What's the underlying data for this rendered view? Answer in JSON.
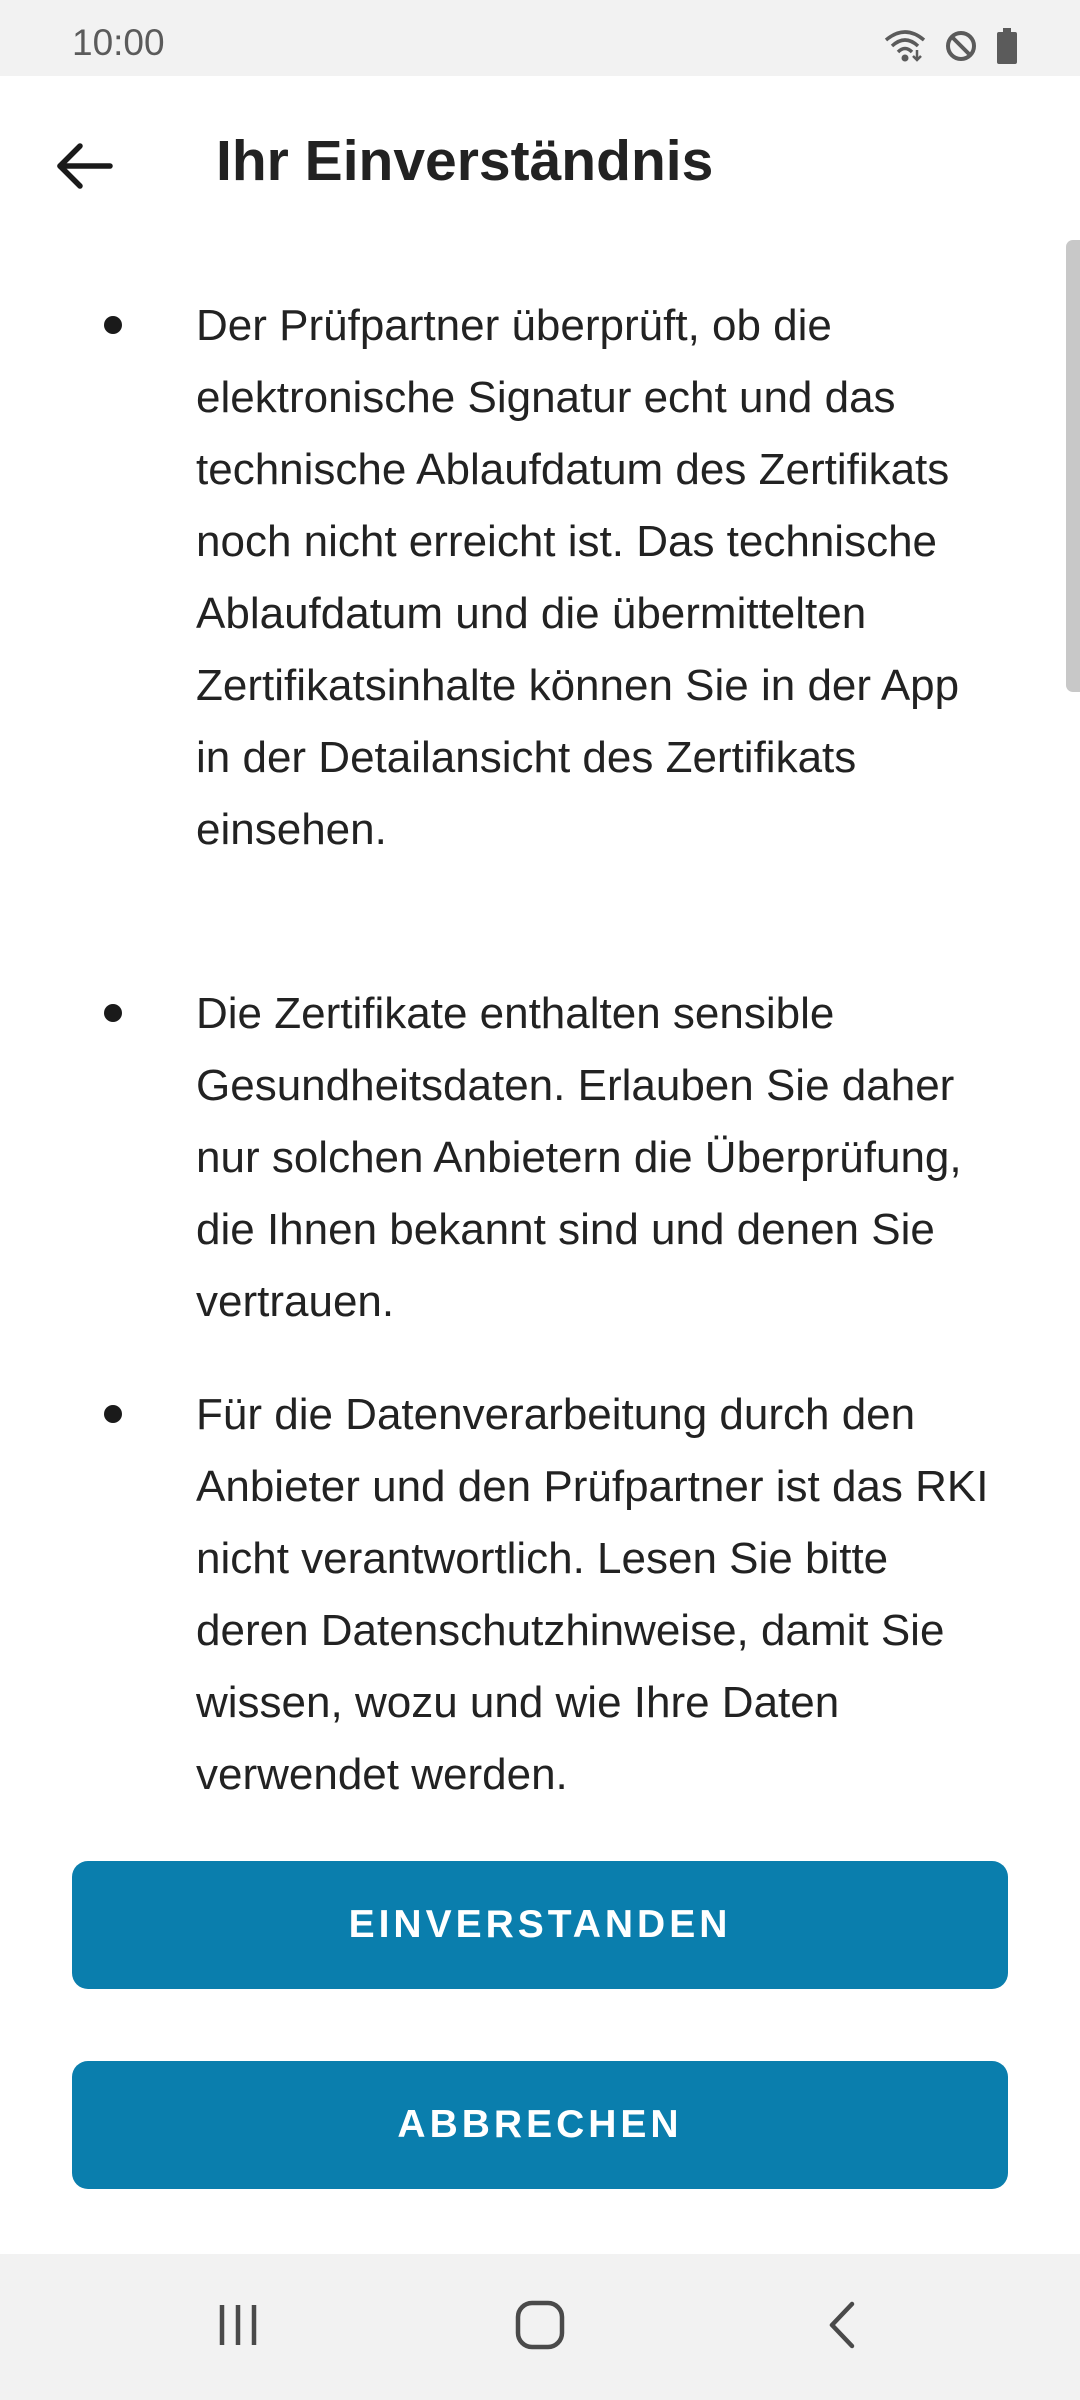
{
  "status_bar": {
    "time": "10:00",
    "icons": [
      "wifi-icon",
      "do-not-disturb-icon",
      "battery-icon"
    ]
  },
  "app_bar": {
    "back_icon": "arrow-left-icon",
    "title": "Ihr Einverständnis"
  },
  "content": {
    "bullets": [
      {
        "text": "Der Prüfpartner überprüft, ob die elektronische Signatur echt und das technische Ablaufdatum des Zertifikats noch nicht erreicht ist. Das technische Ablaufdatum und die übermittelten Zertifikatsinhalte können Sie in der App in der Detailansicht des Zertifikats einsehen."
      },
      {
        "text": "Die Zertifikate enthalten sensible Gesundheitsdaten. Erlauben Sie daher nur solchen Anbietern die Überprüfung, die Ihnen bekannt sind und denen Sie vertrauen."
      },
      {
        "text": "Für die Datenverarbeitung durch den Anbieter und den Prüfpartner ist das RKI nicht verantwortlich. Lesen Sie bitte deren Datenschutzhinweise, damit Sie wissen, wozu und wie Ihre Daten verwendet werden."
      }
    ]
  },
  "buttons": {
    "agree_label": "EINVERSTANDEN",
    "cancel_label": "ABBRECHEN"
  },
  "colors": {
    "accent": "#0a7ead",
    "background": "#ffffff",
    "system_bar": "#f2f2f2"
  },
  "nav_bar": {
    "icons": [
      "recent-apps-icon",
      "home-icon",
      "back-nav-icon"
    ]
  }
}
